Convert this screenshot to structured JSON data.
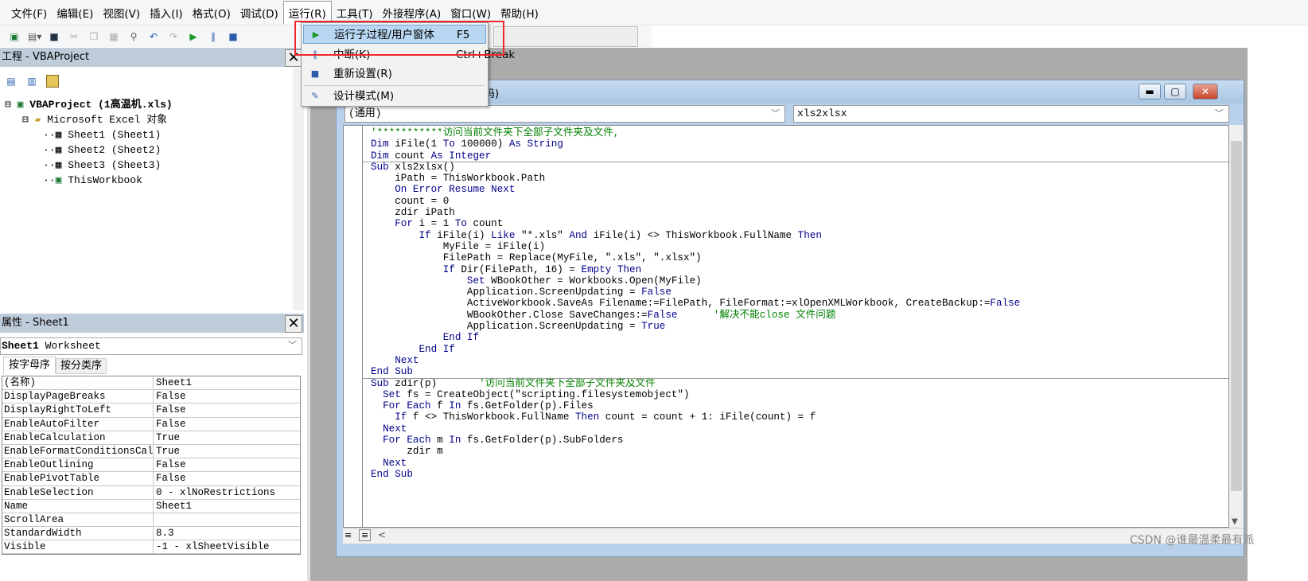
{
  "menubar": [
    "文件(F)",
    "编辑(E)",
    "视图(V)",
    "插入(I)",
    "格式(O)",
    "调试(D)",
    "运行(R)",
    "工具(T)",
    "外接程序(A)",
    "窗口(W)",
    "帮助(H)"
  ],
  "run_menu": {
    "items": [
      {
        "label": "运行子过程/用户窗体",
        "shortcut": "F5",
        "icon": "play-icon",
        "highlighted": true
      },
      {
        "label": "中断(K)",
        "shortcut": "Ctrl+Break",
        "icon": "pause-icon"
      },
      {
        "label": "重新设置(R)",
        "shortcut": "",
        "icon": "stop-icon"
      },
      {
        "label": "设计模式(M)",
        "shortcut": "",
        "icon": "design-mode-icon"
      }
    ]
  },
  "project": {
    "title": "工程 - VBAProject",
    "tree": [
      "VBAProject (1高温机.xls)",
      "Microsoft Excel 对象",
      "Sheet1 (Sheet1)",
      "Sheet2 (Sheet2)",
      "Sheet3 (Sheet3)",
      "ThisWorkbook"
    ]
  },
  "properties": {
    "title": "属性 - Sheet1",
    "object_name": "Sheet1",
    "object_type": "Worksheet",
    "tabs": [
      "按字母序",
      "按分类序"
    ],
    "rows": [
      [
        "(名称)",
        "Sheet1"
      ],
      [
        "DisplayPageBreaks",
        "False"
      ],
      [
        "DisplayRightToLeft",
        "False"
      ],
      [
        "EnableAutoFilter",
        "False"
      ],
      [
        "EnableCalculation",
        "True"
      ],
      [
        "EnableFormatConditionsCalculation",
        "True"
      ],
      [
        "EnableOutlining",
        "False"
      ],
      [
        "EnablePivotTable",
        "False"
      ],
      [
        "EnableSelection",
        "0 - xlNoRestrictions"
      ],
      [
        "Name",
        "Sheet1"
      ],
      [
        "ScrollArea",
        ""
      ],
      [
        "StandardWidth",
        "8.3"
      ],
      [
        "Visible",
        "-1 - xlSheetVisible"
      ]
    ]
  },
  "codewindow": {
    "title_fragment": "码)",
    "object_combo": "(通用)",
    "proc_combo": "xls2xlsx",
    "lines": [
      [
        [
          "cm",
          "'***********访问当前文件夹下全部子文件夹及文件,"
        ]
      ],
      [
        [
          "kw",
          "Dim"
        ],
        [
          "pl",
          " iFile(1 "
        ],
        [
          "kw",
          "To"
        ],
        [
          "pl",
          " 100000) "
        ],
        [
          "kw",
          "As String"
        ]
      ],
      [
        [
          "kw",
          "Dim"
        ],
        [
          "pl",
          " count "
        ],
        [
          "kw",
          "As Integer"
        ]
      ],
      [
        [
          "kw",
          "Sub"
        ],
        [
          "pl",
          " xls2xlsx()"
        ]
      ],
      [
        [
          "pl",
          "    iPath = ThisWorkbook.Path"
        ]
      ],
      [
        [
          "pl",
          "    "
        ],
        [
          "kw",
          "On Error Resume Next"
        ]
      ],
      [
        [
          "pl",
          "    count = 0"
        ]
      ],
      [
        [
          "pl",
          "    zdir iPath"
        ]
      ],
      [
        [
          "pl",
          "    "
        ],
        [
          "kw",
          "For"
        ],
        [
          "pl",
          " i = 1 "
        ],
        [
          "kw",
          "To"
        ],
        [
          "pl",
          " count"
        ]
      ],
      [
        [
          "pl",
          "        "
        ],
        [
          "kw",
          "If"
        ],
        [
          "pl",
          " iFile(i) "
        ],
        [
          "kw",
          "Like"
        ],
        [
          "pl",
          " \"*.xls\" "
        ],
        [
          "kw",
          "And"
        ],
        [
          "pl",
          " iFile(i) <> ThisWorkbook.FullName "
        ],
        [
          "kw",
          "Then"
        ]
      ],
      [
        [
          "pl",
          "            MyFile = iFile(i)"
        ]
      ],
      [
        [
          "pl",
          "            FilePath = Replace(MyFile, \".xls\", \".xlsx\")"
        ]
      ],
      [
        [
          "pl",
          "            "
        ],
        [
          "kw",
          "If"
        ],
        [
          "pl",
          " Dir(FilePath, 16) = "
        ],
        [
          "kw",
          "Empty Then"
        ]
      ],
      [
        [
          "pl",
          "                "
        ],
        [
          "kw",
          "Set"
        ],
        [
          "pl",
          " WBookOther = Workbooks.Open(MyFile)"
        ]
      ],
      [
        [
          "pl",
          "                Application.ScreenUpdating = "
        ],
        [
          "kw",
          "False"
        ]
      ],
      [
        [
          "pl",
          "                ActiveWorkbook.SaveAs Filename:=FilePath, FileFormat:=xlOpenXMLWorkbook, CreateBackup:="
        ],
        [
          "kw",
          "False"
        ]
      ],
      [
        [
          "pl",
          "                WBookOther.Close SaveChanges:="
        ],
        [
          "kw",
          "False"
        ],
        [
          "cm",
          "      '解决不能close 文件问题"
        ]
      ],
      [
        [
          "pl",
          "                Application.ScreenUpdating = "
        ],
        [
          "kw",
          "True"
        ]
      ],
      [
        [
          "pl",
          "            "
        ],
        [
          "kw",
          "End If"
        ]
      ],
      [
        [
          "pl",
          "        "
        ],
        [
          "kw",
          "End If"
        ]
      ],
      [
        [
          "pl",
          "    "
        ],
        [
          "kw",
          "Next"
        ]
      ],
      [
        [
          "kw",
          "End Sub"
        ]
      ],
      [
        [
          "kw",
          "Sub"
        ],
        [
          "pl",
          " zdir(p)       "
        ],
        [
          "cm",
          "'访问当前文件夹下全部子文件夹及文件"
        ]
      ],
      [
        [
          "pl",
          "  "
        ],
        [
          "kw",
          "Set"
        ],
        [
          "pl",
          " fs = CreateObject(\"scripting.filesystemobject\")"
        ]
      ],
      [
        [
          "pl",
          "  "
        ],
        [
          "kw",
          "For Each"
        ],
        [
          "pl",
          " f "
        ],
        [
          "kw",
          "In"
        ],
        [
          "pl",
          " fs.GetFolder(p).Files"
        ]
      ],
      [
        [
          "pl",
          "    "
        ],
        [
          "kw",
          "If"
        ],
        [
          "pl",
          " f <> ThisWorkbook.FullName "
        ],
        [
          "kw",
          "Then"
        ],
        [
          "pl",
          " count = count + 1: iFile(count) = f"
        ]
      ],
      [
        [
          "pl",
          "  "
        ],
        [
          "kw",
          "Next"
        ]
      ],
      [
        [
          "pl",
          "  "
        ],
        [
          "kw",
          "For Each"
        ],
        [
          "pl",
          " m "
        ],
        [
          "kw",
          "In"
        ],
        [
          "pl",
          " fs.GetFolder(p).SubFolders"
        ]
      ],
      [
        [
          "pl",
          "      zdir m"
        ]
      ],
      [
        [
          "pl",
          "  "
        ],
        [
          "kw",
          "Next"
        ]
      ],
      [
        [
          "kw",
          "End Sub"
        ]
      ]
    ]
  },
  "watermark": "CSDN @谁最温柔最有派",
  "colors": {
    "keyword": "#00008b",
    "comment": "#008000",
    "highlight_box": "#f0262c",
    "menu_highlight": "#b9d7f2"
  }
}
